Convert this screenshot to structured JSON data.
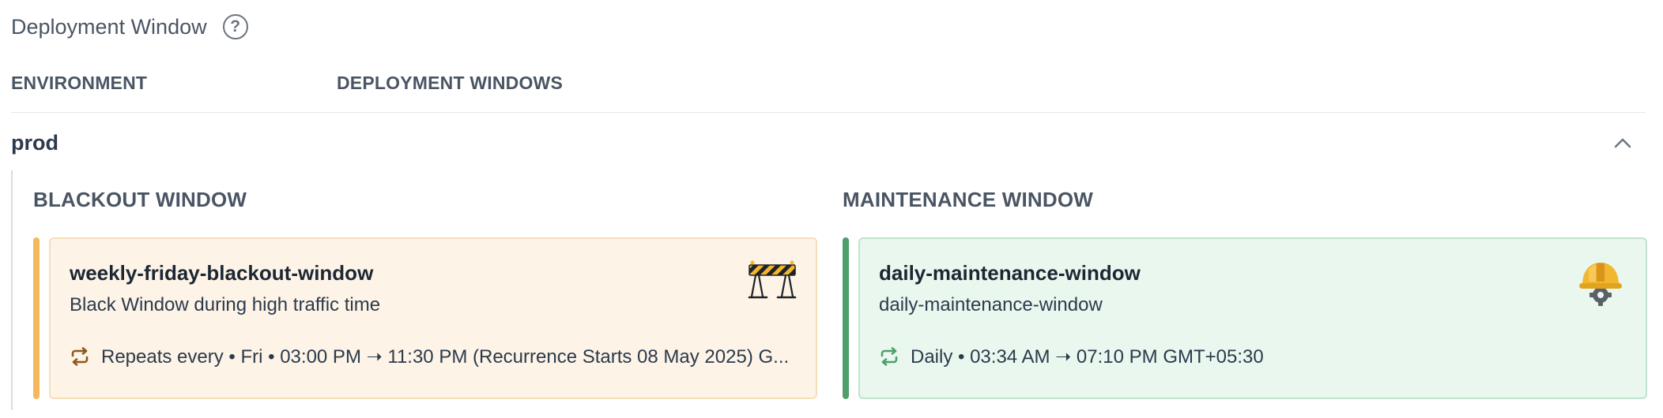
{
  "header": {
    "title": "Deployment Window",
    "help_icon": "question-circle-icon"
  },
  "columns": {
    "environment": "ENVIRONMENT",
    "deployment_windows": "DEPLOYMENT WINDOWS"
  },
  "environment": {
    "name": "prod",
    "expanded": true,
    "collapse_icon": "chevron-up-icon"
  },
  "blackout": {
    "section_title": "BLACKOUT WINDOW",
    "accent_color": "#f4b95c",
    "card": {
      "name": "weekly-friday-blackout-window",
      "description": "Black Window during high traffic time",
      "schedule": "Repeats every • Fri • 03:00 PM ➝ 11:30 PM (Recurrence Starts 08 May 2025) G...",
      "repeat_icon": "repeat-icon",
      "badge_icon": "barrier-icon"
    }
  },
  "maintenance": {
    "section_title": "MAINTENANCE WINDOW",
    "accent_color": "#4e9f6c",
    "card": {
      "name": "daily-maintenance-window",
      "description": "daily-maintenance-window",
      "schedule": "Daily • 03:34 AM ➝ 07:10 PM GMT+05:30",
      "repeat_icon": "repeat-icon",
      "badge_icon": "hard-hat-icon"
    }
  }
}
